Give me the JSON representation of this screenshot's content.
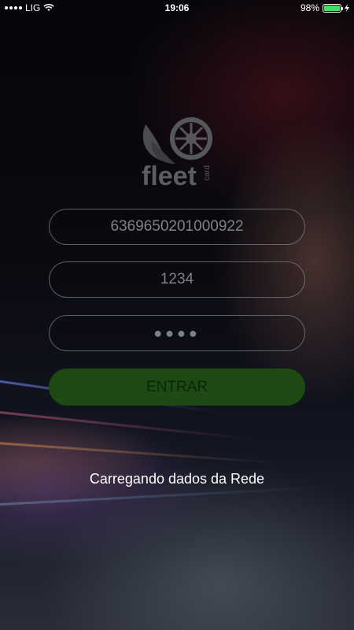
{
  "status_bar": {
    "carrier": "LIG",
    "time": "19:06",
    "battery_percent": "98%",
    "battery_level": 0.98,
    "battery_color": "#4cd964"
  },
  "logo": {
    "brand": "fleet",
    "sub": "card",
    "icon": "wheel-leaf-icon"
  },
  "form": {
    "card_number": "6369650201000922",
    "user_code": "1234",
    "password_mask": "●●●●",
    "submit_label": "ENTRAR"
  },
  "status_message": "Carregando dados da Rede",
  "colors": {
    "button_bg": "#1c4a12",
    "field_border": "#787d87"
  }
}
